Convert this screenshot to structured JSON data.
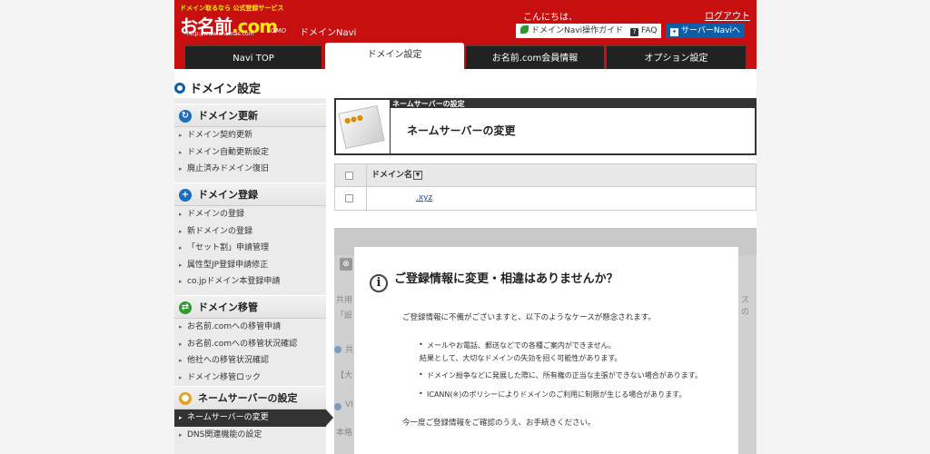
{
  "header": {
    "logo_tagline": "ドメイン取るなら 公式登録サービス",
    "logo_name": "お名前",
    "logo_ext": ".com",
    "logo_url": "http://www.onamae.com",
    "logo_gmo": "GMO",
    "brand": "ドメインNavi",
    "greeting": "こんにちは、",
    "logout": "ログアウト",
    "guide_button": "ドメインNavi操作ガイド",
    "faq_button": "FAQ",
    "server_button": "サーバーNaviへ",
    "colors": {
      "header_bg": "#c70f0f",
      "accent": "#0d5ea8"
    }
  },
  "nav": {
    "tabs": [
      {
        "label": "Navi TOP"
      },
      {
        "label": "ドメイン設定"
      },
      {
        "label": "お名前.com会員情報"
      },
      {
        "label": "オプション設定"
      }
    ],
    "active": "ドメイン設定"
  },
  "section_title": "ドメイン設定",
  "sidebar": {
    "groups": [
      {
        "title": "ドメイン更新",
        "icon": "refresh-icon",
        "items": [
          "ドメイン契約更新",
          "ドメイン自動更新設定",
          "廃止済みドメイン復旧"
        ]
      },
      {
        "title": "ドメイン登録",
        "icon": "plus-icon",
        "items": [
          "ドメインの登録",
          "新ドメインの登録",
          "「セット割」申請管理",
          "属性型JP登録申請修正",
          "co.jpドメイン本登録申請"
        ]
      },
      {
        "title": "ドメイン移管",
        "icon": "transfer-icon",
        "items": [
          "お名前.comへの移管申請",
          "お名前.comへの移管状況確認",
          "他社への移管状況確認",
          "ドメイン移管ロック"
        ]
      },
      {
        "title": "ネームサーバーの設定",
        "icon": "server-user-icon",
        "items": [
          "ネームサーバーの変更",
          "DNS関連機能の設定"
        ]
      }
    ],
    "active_item": "ネームサーバーの変更"
  },
  "main": {
    "box_small_title": "ネームサーバーの設定",
    "box_title": "ネームサーバーの変更",
    "table": {
      "column_header": "ドメイン名",
      "rows": [
        {
          "domain": ".xyz"
        }
      ]
    },
    "background_fragments": [
      "共用",
      "「設",
      "共",
      "【大",
      "VI",
      "本格",
      "スの"
    ]
  },
  "dialog": {
    "title": "ご登録情報に変更・相違はありませんか？",
    "intro": "ご登録情報に不備がございますと、以下のようなケースが懸念されます。",
    "bullets": [
      {
        "line1": "メールやお電話、郵送などでの各種ご案内ができません。",
        "line2": "結果として、大切なドメインの失効を招く可能性があります。"
      },
      {
        "line1": "ドメイン紛争などに発展した際に、所有権の正当な主張ができない場合があります。"
      },
      {
        "line1": "ICANN(※)のポリシーによりドメインのご利用に制限が生じる場合があります。"
      }
    ],
    "closing": "今一度ご登録情報をご確認のうえ、お手続きください。"
  }
}
